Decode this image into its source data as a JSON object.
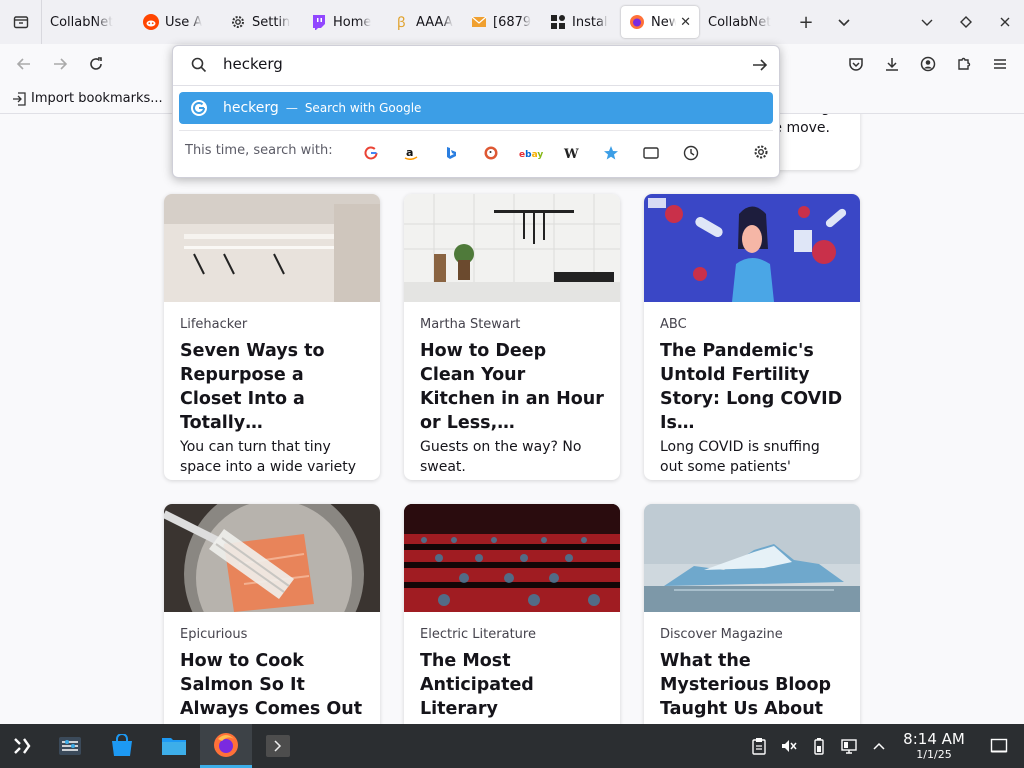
{
  "tabs": [
    {
      "title": "CollabNet",
      "favicon": "none"
    },
    {
      "title": "Use A",
      "favicon": "reddit-icon"
    },
    {
      "title": "Settin",
      "favicon": "gear-icon"
    },
    {
      "title": "Home",
      "favicon": "twitch-icon"
    },
    {
      "title": "AAAA",
      "favicon": "coin-icon"
    },
    {
      "title": "[6879",
      "favicon": "mail-icon"
    },
    {
      "title": "Instal",
      "favicon": "puzzle-icon"
    },
    {
      "title": "New",
      "favicon": "firefox-icon",
      "active": true
    },
    {
      "title": "CollabNet",
      "favicon": "none"
    }
  ],
  "bookmarks": {
    "import_label": "Import bookmarks..."
  },
  "urlbar": {
    "value": "heckerg",
    "suggestion_query": "heckerg",
    "suggestion_dash": "—",
    "suggestion_action": "Search with Google",
    "one_off_label": "This time, search with:",
    "engines": [
      "google-icon",
      "amazon-icon",
      "bing-icon",
      "duckduckgo-icon",
      "ebay-icon",
      "wikipedia-icon",
      "bookmarks-star-icon",
      "tabs-icon",
      "history-icon"
    ]
  },
  "partial_card": {
    "line1": "g",
    "line2": "e move."
  },
  "cards": [
    {
      "source": "Lifehacker",
      "headline": "Seven Ways to Repurpose a Closet Into a Totally…",
      "excerpt": "You can turn that tiny space into a wide variety of useful “rooms.”"
    },
    {
      "source": "Martha Stewart",
      "headline": "How to Deep Clean Your Kitchen in an Hour or Less,…",
      "excerpt": "Guests on the way? No sweat."
    },
    {
      "source": "ABC",
      "headline": "The Pandemic's Untold Fertility Story: Long COVID Is…",
      "excerpt": "Long COVID is snuffing out some patients' dreams of having children, and…"
    },
    {
      "source": "Epicurious",
      "headline": "How to Cook Salmon So It Always Comes Out Perfectly",
      "excerpt": ""
    },
    {
      "source": "Electric Literature",
      "headline": "The Most Anticipated Literary Adaptations Coming to TV and…",
      "excerpt": ""
    },
    {
      "source": "Discover Magazine",
      "headline": "What the Mysterious Bloop Taught Us About Antarctica",
      "excerpt": ""
    }
  ],
  "taskbar": {
    "time": "8:14 AM",
    "date": "1/1/25"
  },
  "colors": {
    "accent": "#3c9ee6",
    "taskbar": "#2b2e31"
  }
}
